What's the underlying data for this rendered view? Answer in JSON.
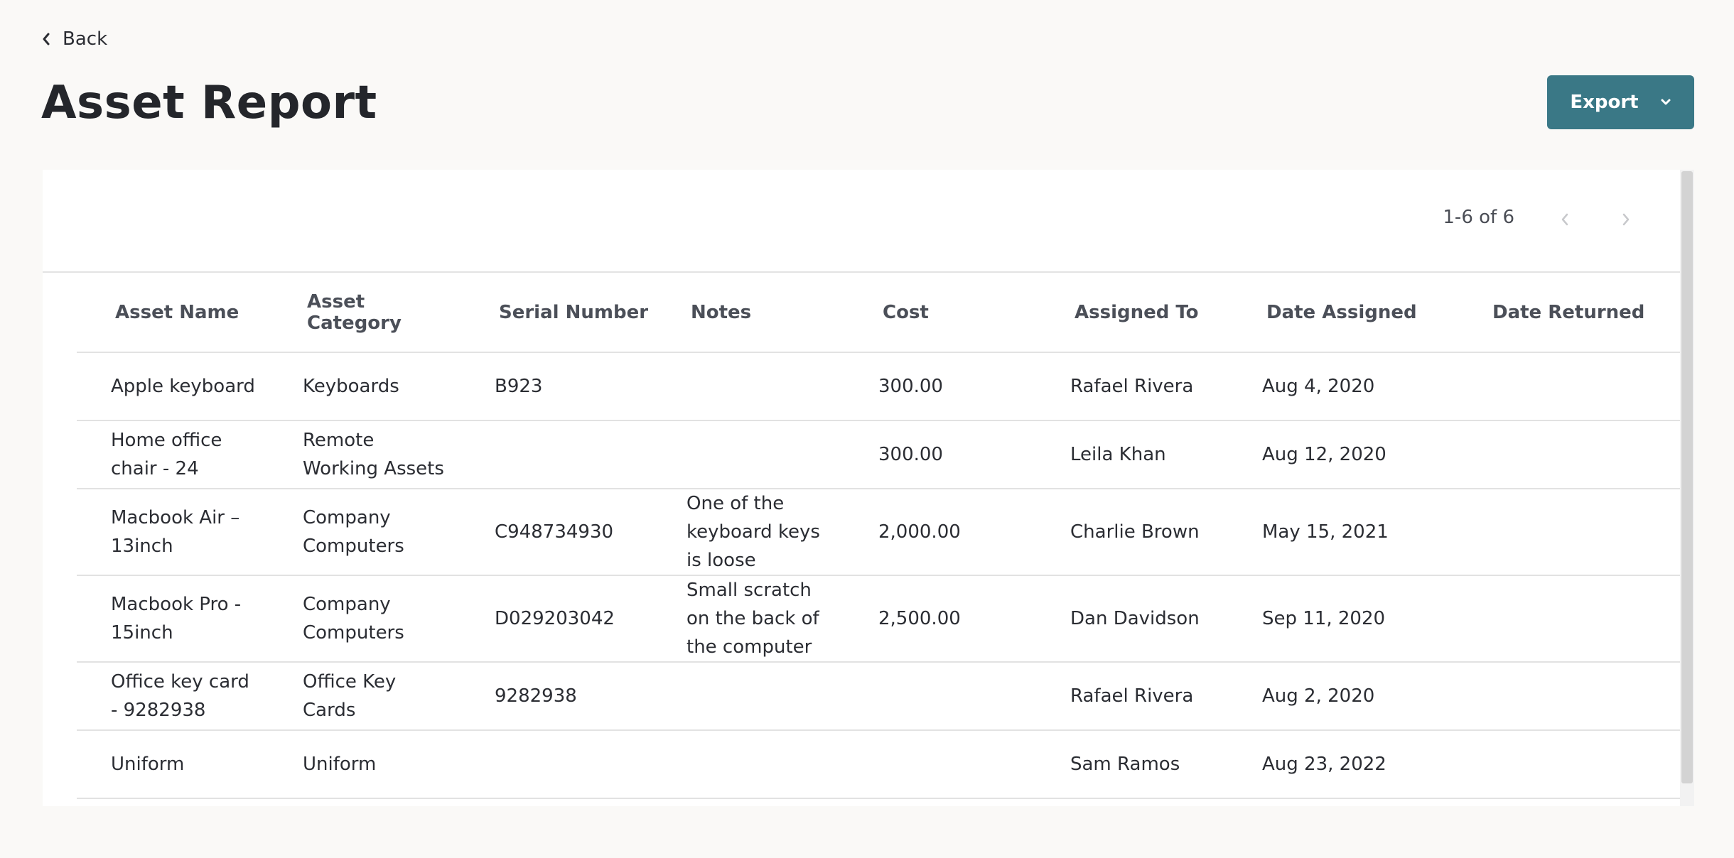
{
  "nav": {
    "back_label": "Back"
  },
  "header": {
    "title": "Asset Report",
    "export_label": "Export"
  },
  "pagination": {
    "range_label": "1-6 of 6"
  },
  "colors": {
    "accent": "#3a7886",
    "background": "#faf9f7",
    "card": "#ffffff"
  },
  "icons": {
    "back": "chevron-left-icon",
    "export_dropdown": "chevron-down-icon",
    "prev": "chevron-left-icon",
    "next": "chevron-right-icon"
  },
  "table": {
    "columns": [
      "Asset Name",
      "Asset Category",
      "Serial Number",
      "Notes",
      "Cost",
      "Assigned To",
      "Date Assigned",
      "Date Returned"
    ],
    "rows": [
      {
        "name": "Apple keyboard",
        "category": "Keyboards",
        "serial": "B923",
        "notes": "",
        "cost": "300.00",
        "assigned_to": "Rafael Rivera",
        "date_assigned": "Aug 4, 2020",
        "date_returned": ""
      },
      {
        "name": "Home office chair - 24",
        "category": "Remote Working Assets",
        "serial": "",
        "notes": "",
        "cost": "300.00",
        "assigned_to": "Leila Khan",
        "date_assigned": "Aug 12, 2020",
        "date_returned": ""
      },
      {
        "name": "Macbook Air – 13inch",
        "category": "Company Computers",
        "serial": "C948734930",
        "notes": "One of the keyboard keys is loose",
        "cost": "2,000.00",
        "assigned_to": "Charlie Brown",
        "date_assigned": "May 15, 2021",
        "date_returned": ""
      },
      {
        "name": "Macbook Pro - 15inch",
        "category": "Company Computers",
        "serial": "D029203042",
        "notes": "Small scratch on the back of the computer",
        "cost": "2,500.00",
        "assigned_to": "Dan Davidson",
        "date_assigned": "Sep 11, 2020",
        "date_returned": ""
      },
      {
        "name": "Office key card - 9282938",
        "category": "Office Key Cards",
        "serial": "9282938",
        "notes": "",
        "cost": "",
        "assigned_to": "Rafael Rivera",
        "date_assigned": "Aug 2, 2020",
        "date_returned": ""
      },
      {
        "name": "Uniform",
        "category": "Uniform",
        "serial": "",
        "notes": "",
        "cost": "",
        "assigned_to": "Sam Ramos",
        "date_assigned": "Aug 23, 2022",
        "date_returned": ""
      }
    ]
  }
}
